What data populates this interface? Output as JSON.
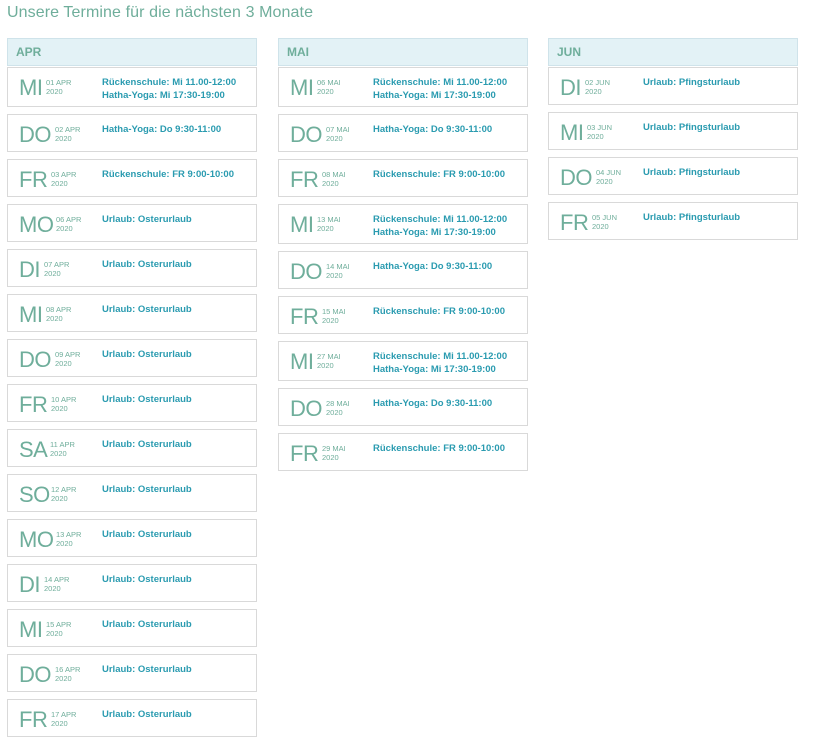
{
  "title": "Unsere Termine für die nächsten 3 Monate",
  "months": [
    {
      "name": "APR",
      "entries": [
        {
          "day": "MI",
          "date": "01 APR",
          "year": "2020",
          "lines": [
            "Rückenschule: Mi 11.00-12:00",
            "Hatha-Yoga: Mi 17:30-19:00"
          ]
        },
        {
          "day": "DO",
          "date": "02 APR",
          "year": "2020",
          "lines": [
            "Hatha-Yoga: Do 9:30-11:00"
          ]
        },
        {
          "day": "FR",
          "date": "03 APR",
          "year": "2020",
          "lines": [
            "Rückenschule: FR 9:00-10:00"
          ]
        },
        {
          "day": "MO",
          "date": "06 APR",
          "year": "2020",
          "lines": [
            "Urlaub: Osterurlaub"
          ]
        },
        {
          "day": "DI",
          "date": "07 APR",
          "year": "2020",
          "lines": [
            "Urlaub: Osterurlaub"
          ]
        },
        {
          "day": "MI",
          "date": "08 APR",
          "year": "2020",
          "lines": [
            "Urlaub: Osterurlaub"
          ]
        },
        {
          "day": "DO",
          "date": "09 APR",
          "year": "2020",
          "lines": [
            "Urlaub: Osterurlaub"
          ]
        },
        {
          "day": "FR",
          "date": "10 APR",
          "year": "2020",
          "lines": [
            "Urlaub: Osterurlaub"
          ]
        },
        {
          "day": "SA",
          "date": "11 APR",
          "year": "2020",
          "lines": [
            "Urlaub: Osterurlaub"
          ]
        },
        {
          "day": "SO",
          "date": "12 APR",
          "year": "2020",
          "lines": [
            "Urlaub: Osterurlaub"
          ]
        },
        {
          "day": "MO",
          "date": "13 APR",
          "year": "2020",
          "lines": [
            "Urlaub: Osterurlaub"
          ]
        },
        {
          "day": "DI",
          "date": "14 APR",
          "year": "2020",
          "lines": [
            "Urlaub: Osterurlaub"
          ]
        },
        {
          "day": "MI",
          "date": "15 APR",
          "year": "2020",
          "lines": [
            "Urlaub: Osterurlaub"
          ]
        },
        {
          "day": "DO",
          "date": "16 APR",
          "year": "2020",
          "lines": [
            "Urlaub: Osterurlaub"
          ]
        },
        {
          "day": "FR",
          "date": "17 APR",
          "year": "2020",
          "lines": [
            "Urlaub: Osterurlaub"
          ]
        }
      ]
    },
    {
      "name": "MAI",
      "entries": [
        {
          "day": "MI",
          "date": "06 MAI",
          "year": "2020",
          "lines": [
            "Rückenschule: Mi 11.00-12:00",
            "Hatha-Yoga: Mi 17:30-19:00"
          ]
        },
        {
          "day": "DO",
          "date": "07 MAI",
          "year": "2020",
          "lines": [
            "Hatha-Yoga: Do 9:30-11:00"
          ]
        },
        {
          "day": "FR",
          "date": "08 MAI",
          "year": "2020",
          "lines": [
            "Rückenschule: FR 9:00-10:00"
          ]
        },
        {
          "day": "MI",
          "date": "13 MAI",
          "year": "2020",
          "lines": [
            "Rückenschule: Mi 11.00-12:00",
            "Hatha-Yoga: Mi 17:30-19:00"
          ]
        },
        {
          "day": "DO",
          "date": "14 MAI",
          "year": "2020",
          "lines": [
            "Hatha-Yoga: Do 9:30-11:00"
          ]
        },
        {
          "day": "FR",
          "date": "15 MAI",
          "year": "2020",
          "lines": [
            "Rückenschule: FR 9:00-10:00"
          ]
        },
        {
          "day": "MI",
          "date": "27 MAI",
          "year": "2020",
          "lines": [
            "Rückenschule: Mi 11.00-12:00",
            "Hatha-Yoga: Mi 17:30-19:00"
          ]
        },
        {
          "day": "DO",
          "date": "28 MAI",
          "year": "2020",
          "lines": [
            "Hatha-Yoga: Do 9:30-11:00"
          ]
        },
        {
          "day": "FR",
          "date": "29 MAI",
          "year": "2020",
          "lines": [
            "Rückenschule: FR 9:00-10:00"
          ]
        }
      ]
    },
    {
      "name": "JUN",
      "entries": [
        {
          "day": "DI",
          "date": "02 JUN",
          "year": "2020",
          "lines": [
            "Urlaub: Pfingsturlaub"
          ]
        },
        {
          "day": "MI",
          "date": "03 JUN",
          "year": "2020",
          "lines": [
            "Urlaub: Pfingsturlaub"
          ]
        },
        {
          "day": "DO",
          "date": "04 JUN",
          "year": "2020",
          "lines": [
            "Urlaub: Pfingsturlaub"
          ]
        },
        {
          "day": "FR",
          "date": "05 JUN",
          "year": "2020",
          "lines": [
            "Urlaub: Pfingsturlaub"
          ]
        }
      ]
    }
  ]
}
